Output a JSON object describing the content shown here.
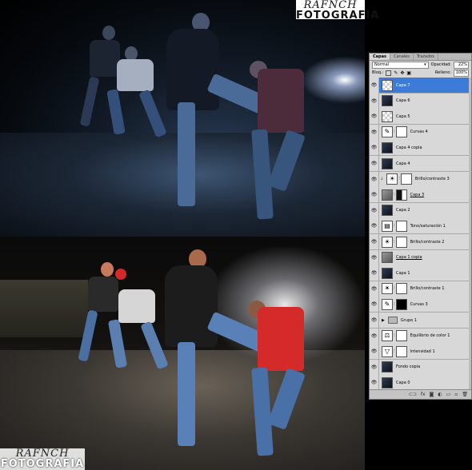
{
  "logo_top": {
    "signature": "RAFNCH",
    "word": "FOTOGRAFIA"
  },
  "logo_bottom": {
    "signature": "RAFNCH",
    "word": "FOTOGRAFIA"
  },
  "panel": {
    "tabs": [
      "Capas",
      "Canales",
      "Trazados"
    ],
    "active_tab": "Capas",
    "blend_mode": "Normal",
    "opacity_label": "Opacidad:",
    "opacity_value": "22%",
    "lock_label": "Bloq.:",
    "fill_label": "Relleno:",
    "fill_value": "100%"
  },
  "layers": [
    {
      "name": "Capa 7",
      "thumb": "t-trans",
      "selected": true,
      "underline": false
    },
    {
      "name": "Capa 6",
      "thumb": "t-photo"
    },
    {
      "name": "Capa 5",
      "thumb": "t-trans"
    },
    {
      "name": "Curvas 4",
      "thumb": "t-adj",
      "icon": "✎",
      "mask": "t-mask"
    },
    {
      "name": "Capa 4 copia",
      "thumb": "t-photo"
    },
    {
      "name": "Capa 4",
      "thumb": "t-photo"
    },
    {
      "name": "Brillo/contraste 3",
      "thumb": "t-adj",
      "icon": "☀",
      "mask": "t-mask",
      "fx": true
    },
    {
      "name": "Capa 3",
      "thumb": "t-grey",
      "mask": "t-mask-part",
      "underline": true
    },
    {
      "name": "Capa 2",
      "thumb": "t-photo"
    },
    {
      "name": "Tono/saturación 1",
      "thumb": "t-adj",
      "icon": "▤",
      "mask": "t-mask"
    },
    {
      "name": "Brillo/contraste 2",
      "thumb": "t-adj",
      "icon": "☀",
      "mask": "t-mask"
    },
    {
      "name": "Capa 1 copia",
      "thumb": "t-grey",
      "underline": true
    },
    {
      "name": "Capa 1",
      "thumb": "t-photo"
    },
    {
      "name": "Brillo/contraste 1",
      "thumb": "t-adj",
      "icon": "☀",
      "mask": "t-mask"
    },
    {
      "name": "Curvas 3",
      "thumb": "t-adj",
      "icon": "✎",
      "mask": "t-mask-black"
    },
    {
      "name": "Grupo 1",
      "folder": true
    },
    {
      "name": "Equilibrio de color 1",
      "thumb": "t-adj",
      "icon": "⚖",
      "mask": "t-mask"
    },
    {
      "name": "Intensidad 1",
      "thumb": "t-adj",
      "icon": "▽",
      "mask": "t-mask"
    },
    {
      "name": "Fondo copia",
      "thumb": "t-photo"
    },
    {
      "name": "Capa 0",
      "thumb": "t-photo"
    }
  ],
  "bottom_icons": [
    "link-icon",
    "fx-icon",
    "mask-icon",
    "adjustment-icon",
    "folder-icon",
    "new-layer-icon",
    "trash-icon"
  ],
  "bottom_glyphs": [
    "⊂⊃",
    "fx",
    "◙",
    "◐",
    "▭",
    "▫",
    "🗑"
  ],
  "colors": {
    "selection": "#3d7bd9",
    "panel_bg": "#d6d6d6",
    "jacket_red": "#d42a2a"
  }
}
